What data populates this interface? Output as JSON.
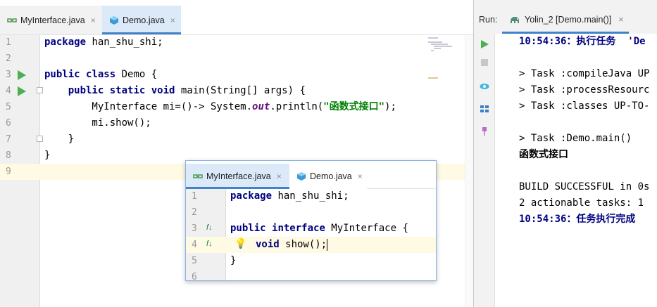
{
  "editor": {
    "tabs": [
      {
        "label": "MyInterface.java",
        "state": "inactive",
        "icon": "interface-file-icon"
      },
      {
        "label": "Demo.java",
        "state": "active",
        "icon": "class-file-icon"
      }
    ],
    "close_glyph": "×",
    "line_numbers": [
      "1",
      "2",
      "3",
      "4",
      "5",
      "6",
      "7",
      "8",
      "9"
    ],
    "code": {
      "l1_kw": "package",
      "l1_rest": " han_shu_shi;",
      "l3_kw1": "public",
      "l3_kw2": "class",
      "l3_rest": " Demo {",
      "l4_indent": "    ",
      "l4_kw1": "public",
      "l4_kw2": "static",
      "l4_kw3": "void",
      "l4_rest": " main(String[] args) {",
      "l5_a": "        MyInterface mi=()-> System.",
      "l5_field": "out",
      "l5_b": ".println(",
      "l5_str": "\"函数式接口\"",
      "l5_c": ");",
      "l6": "        mi.show();",
      "l7": "    }",
      "l8": "}"
    }
  },
  "run_panel": {
    "label": "Run:",
    "tab_label": "Yolin_2 [Demo.main()]",
    "tools": [
      "run-icon",
      "stop-icon",
      "eye-icon",
      "layout-icon",
      "pin-icon"
    ],
    "console": [
      {
        "text": "10:54:36：执行任务  'De",
        "style": "blue-bold"
      },
      {
        "text": "",
        "style": ""
      },
      {
        "text": "> Task :compileJava UP",
        "style": ""
      },
      {
        "text": "> Task :processResourc",
        "style": ""
      },
      {
        "text": "> Task :classes UP-TO-",
        "style": ""
      },
      {
        "text": "",
        "style": ""
      },
      {
        "text": "> Task :Demo.main()",
        "style": ""
      },
      {
        "text": "函数式接口",
        "style": "bold"
      },
      {
        "text": "",
        "style": ""
      },
      {
        "text": "BUILD SUCCESSFUL in 0s",
        "style": ""
      },
      {
        "text": "2 actionable tasks: 1",
        "style": ""
      },
      {
        "text": "10:54:36：任务执行完成",
        "style": "blue-bold"
      }
    ]
  },
  "popup": {
    "tabs": [
      {
        "label": "MyInterface.java",
        "state": "active",
        "icon": "interface-file-icon"
      },
      {
        "label": "Demo.java",
        "state": "inactive",
        "icon": "class-file-icon"
      }
    ],
    "line_numbers": [
      "1",
      "2",
      "3",
      "4",
      "5",
      "6"
    ],
    "code": {
      "l1_kw": "package",
      "l1_rest": " han_shu_shi;",
      "l3_kw1": "public",
      "l3_kw2": "interface",
      "l3_rest": " MyInterface {",
      "l4_kw": "void",
      "l4_rest": " show();",
      "l5": "}"
    },
    "impl_glyph": "f↓",
    "bulb_glyph": "💡"
  },
  "colors": {
    "keyword": "#000080",
    "string": "#008000",
    "accent": "#4083c9",
    "run_green": "#4caf50"
  }
}
